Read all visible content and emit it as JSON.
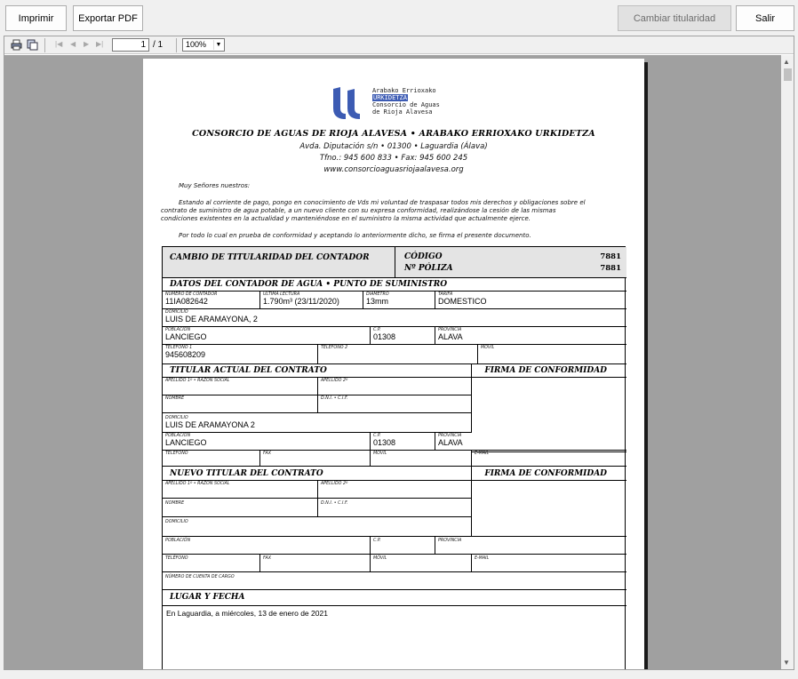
{
  "topbar": {
    "print_label": "Imprimir",
    "export_label": "Exportar PDF",
    "change_owner_label": "Cambiar titularidad",
    "exit_label": "Salir"
  },
  "viewer_toolbar": {
    "current_page": "1",
    "total_pages": "/ 1",
    "zoom": "100%"
  },
  "document": {
    "logo_lines": [
      "Arabako Errioxako",
      "URKIDETZA",
      "Consorcio de Aguas",
      "de Rioja Alavesa"
    ],
    "org_title": "CONSORCIO DE AGUAS DE RIOJA ALAVESA • ARABAKO ERRIOXAKO URKIDETZA",
    "address": "Avda. Diputación s/n • 01300 • Laguardia (Álava)",
    "phone": "Tfno.: 945 600 833 • Fax: 945 600 245",
    "web": "www.consorcioaguasriojaalavesa.org",
    "greeting": "Muy Señores nuestros:",
    "body_lines": [
      "Estando al corriente de pago, pongo en conocimiento de Vds mi voluntad de traspasar todos mis derechos y obligaciones sobre el",
      "contrato de suministro de agua potable, a un nuevo cliente con su expresa conformidad, realizándose la cesión de las mismas",
      "condiciones existentes en la actualidad y manteniéndose en el suministro la misma actividad que actualmente ejerce."
    ],
    "closing": "Por todo lo cual en prueba de conformidad y aceptando lo anteriormente dicho, se firma el presente documento.",
    "form_title": "CAMBIO DE TITULARIDAD DEL CONTADOR",
    "codigo_label": "CÓDIGO",
    "poliza_label": "Nº PÓLIZA",
    "codigo_value": "7881",
    "poliza_value": "7881",
    "meter_section": "DATOS DEL CONTADOR DE AGUA • PUNTO DE SUMINISTRO",
    "meter": {
      "num_label": "NÚMERO DE CONTADOR",
      "num": "11IA082642",
      "lectura_label": "ÚLTIMA LECTURA",
      "lectura": "1.790m³ (23/11/2020)",
      "diametro_label": "DIÁMETRO",
      "diametro": "13mm",
      "tarifa_label": "TARIFA",
      "tarifa": "DOMESTICO",
      "domicilio_label": "DOMICILIO",
      "domicilio": "LUIS DE ARAMAYONA, 2",
      "poblacion_label": "POBLACIÓN",
      "poblacion": "LANCIEGO",
      "cp_label": "C.P.",
      "cp": "01308",
      "provincia_label": "PROVINCIA",
      "provincia": "ALAVA",
      "tel1_label": "TELÉFONO 1",
      "tel1": "945608209",
      "tel2_label": "TELÉFONO 2",
      "movil_label": "MÓVIL"
    },
    "current_section": "TITULAR ACTUAL DEL CONTRATO",
    "firma_label": "FIRMA DE CONFORMIDAD",
    "current": {
      "apellido1_label": "APELLIDO 1º • RAZÓN SOCIAL",
      "apellido2_label": "APELLIDO 2º",
      "nombre_label": "NOMBRE",
      "dni_label": "D.N.I. • C.I.F.",
      "domicilio_label": "DOMICILIO",
      "domicilio": "LUIS DE ARAMAYONA 2",
      "poblacion_label": "POBLACIÓN",
      "poblacion": "LANCIEGO",
      "cp_label": "C.P.",
      "cp": "01308",
      "provincia_label": "PROVINCIA",
      "provincia": "ALAVA",
      "telefono_label": "TELÉFONO",
      "fax_label": "FAX",
      "movil_label": "MÓVIL",
      "email_label": "E-MAIL"
    },
    "new_section": "NUEVO TITULAR DEL CONTRATO",
    "new": {
      "apellido1_label": "APELLIDO 1º • RAZÓN SOCIAL",
      "apellido2_label": "APELLIDO 2º",
      "nombre_label": "NOMBRE",
      "dni_label": "D.N.I. • C.I.F.",
      "domicilio_label": "DOMICILIO",
      "poblacion_label": "POBLACIÓN",
      "cp_label": "C.P.",
      "provincia_label": "PROVINCIA",
      "telefono_label": "TELÉFONO",
      "fax_label": "FAX",
      "movil_label": "MÓVIL",
      "email_label": "E-MAIL",
      "cuenta_label": "NÚMERO DE CUENTA DE CARGO"
    },
    "place_section": "LUGAR Y FECHA",
    "place_value": "En Laguardia, a miércoles, 13 de enero de 2021"
  },
  "colors": {
    "canvas": "#a0a0a0",
    "section_bg": "#e4e4e4",
    "logo_blue": "#3c5bb3"
  },
  "icons": [
    "print-icon",
    "copy-icon",
    "first-page-icon",
    "prev-page-icon",
    "next-page-icon",
    "last-page-icon",
    "dropdown-arrow-icon",
    "scroll-up-icon",
    "scroll-down-icon"
  ]
}
